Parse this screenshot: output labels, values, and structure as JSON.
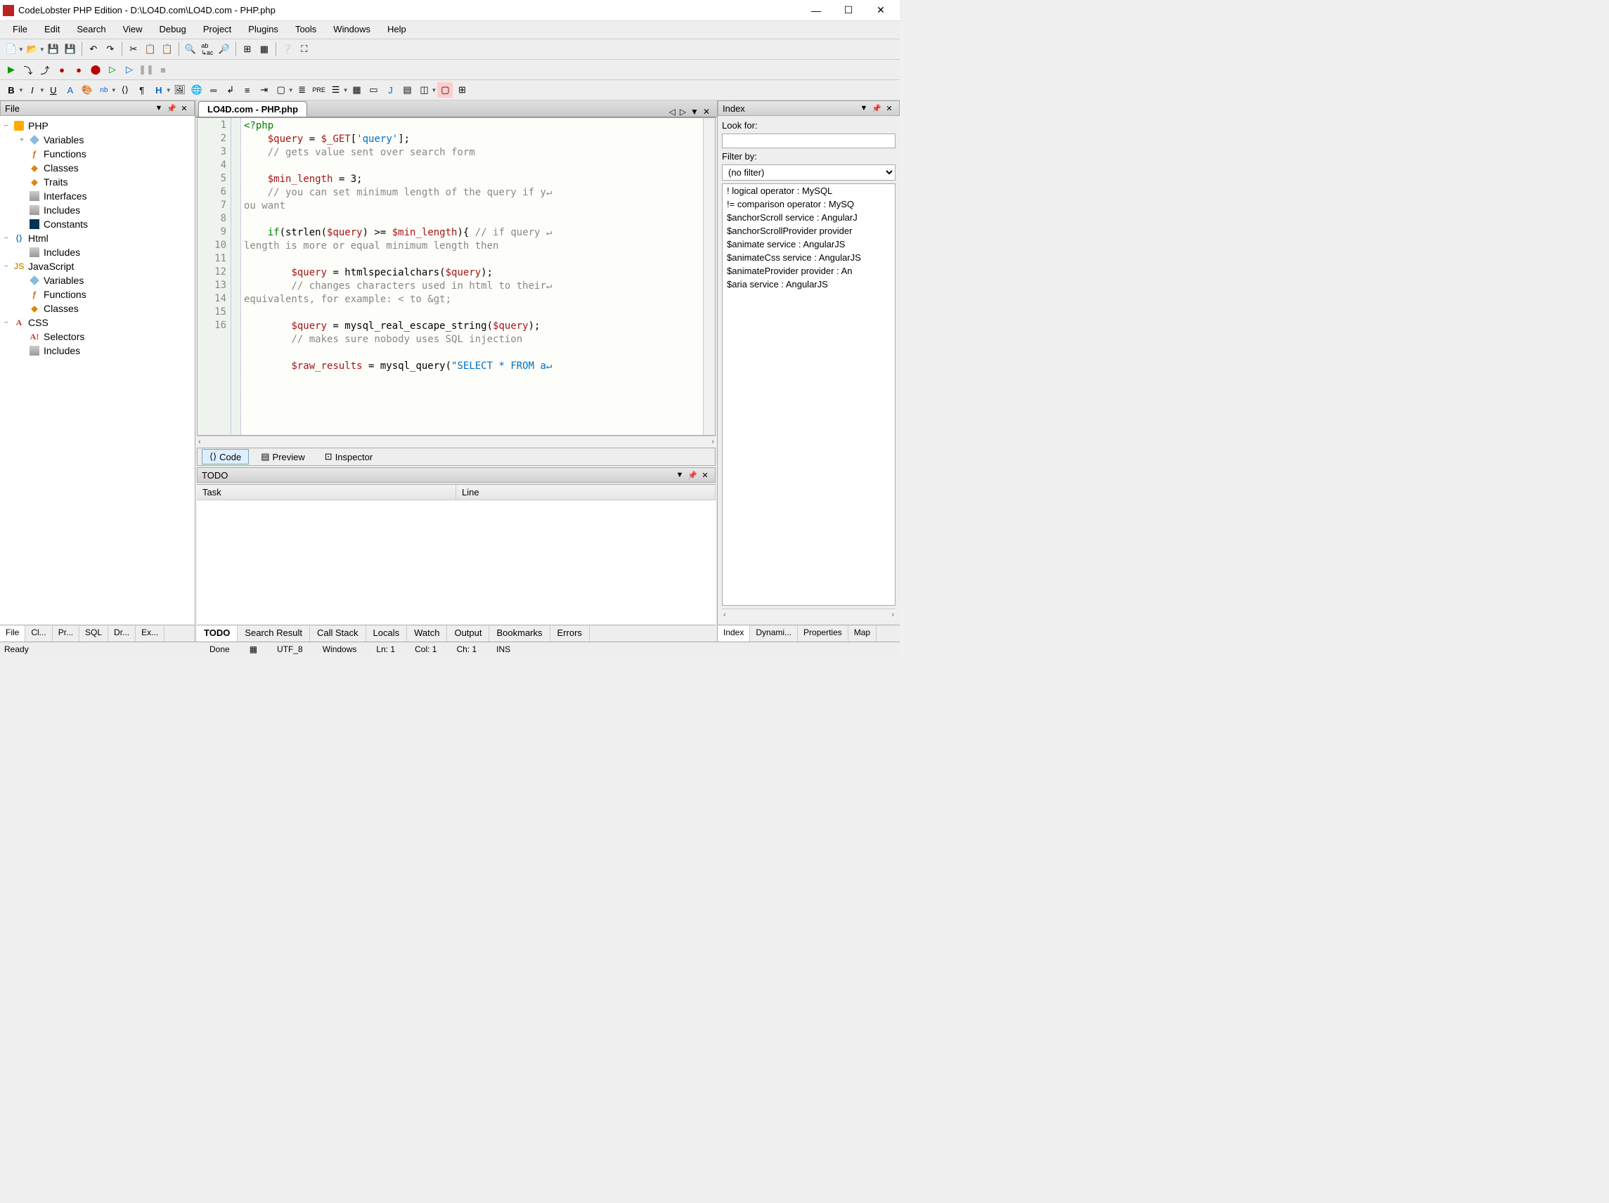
{
  "window": {
    "title": "CodeLobster PHP Edition - D:\\LO4D.com\\LO4D.com - PHP.php"
  },
  "menus": [
    "File",
    "Edit",
    "Search",
    "View",
    "Debug",
    "Project",
    "Plugins",
    "Tools",
    "Windows",
    "Help"
  ],
  "left_panel": {
    "title": "File",
    "tree": [
      {
        "label": "PHP",
        "icon": "php",
        "expander": "−",
        "level": 0,
        "children": true
      },
      {
        "label": "Variables",
        "icon": "cube",
        "expander": "+",
        "level": 1
      },
      {
        "label": "Functions",
        "icon": "func",
        "expander": "",
        "level": 1
      },
      {
        "label": "Classes",
        "icon": "class",
        "expander": "",
        "level": 1
      },
      {
        "label": "Traits",
        "icon": "class",
        "expander": "",
        "level": 1
      },
      {
        "label": "Interfaces",
        "icon": "inc",
        "expander": "",
        "level": 1
      },
      {
        "label": "Includes",
        "icon": "inc",
        "expander": "",
        "level": 1
      },
      {
        "label": "Constants",
        "icon": "const",
        "expander": "",
        "level": 1
      },
      {
        "label": "Html",
        "icon": "html",
        "expander": "−",
        "level": 0,
        "children": true
      },
      {
        "label": "Includes",
        "icon": "inc",
        "expander": "",
        "level": 1
      },
      {
        "label": "JavaScript",
        "icon": "js",
        "expander": "−",
        "level": 0,
        "children": true
      },
      {
        "label": "Variables",
        "icon": "cube",
        "expander": "",
        "level": 1
      },
      {
        "label": "Functions",
        "icon": "func",
        "expander": "",
        "level": 1
      },
      {
        "label": "Classes",
        "icon": "class",
        "expander": "",
        "level": 1
      },
      {
        "label": "CSS",
        "icon": "css",
        "expander": "−",
        "level": 0,
        "children": true
      },
      {
        "label": "Selectors",
        "icon": "sel",
        "expander": "",
        "level": 1
      },
      {
        "label": "Includes",
        "icon": "inc",
        "expander": "",
        "level": 1
      }
    ],
    "tabs": [
      "File",
      "Cl...",
      "Pr...",
      "SQL",
      "Dr...",
      "Ex..."
    ]
  },
  "editor": {
    "tab": "LO4D.com - PHP.php",
    "lines": [
      "1",
      "2",
      "3",
      "4",
      "5",
      "6",
      "7",
      "8",
      "9",
      "10",
      "11",
      "12",
      "13",
      "14",
      "15",
      "16"
    ],
    "code_html": "<span class='kw'>&lt;?php</span>\n    <span class='var'>$query</span> = <span class='var'>$_GET</span>[<span class='str'>'query'</span>];\n    <span class='cmt'>// gets value sent over search form</span>\n\n    <span class='var'>$min_length</span> = 3;\n    <span class='cmt'>// you can set minimum length of the query if y↵\nou want</span>\n\n    <span class='kw'>if</span>(strlen(<span class='var'>$query</span>) &gt;= <span class='var'>$min_length</span>){ <span class='cmt'>// if query ↵\nlength is more or equal minimum length then</span>\n\n        <span class='var'>$query</span> = htmlspecialchars(<span class='var'>$query</span>);\n        <span class='cmt'>// changes characters used in html to their↵\nequivalents, for example: &lt; to &amp;gt;</span>\n\n        <span class='var'>$query</span> = mysql_real_escape_string(<span class='var'>$query</span>);\n        <span class='cmt'>// makes sure nobody uses SQL injection</span>\n\n        <span class='var'>$raw_results</span> = mysql_query(<span class='str'>\"SELECT * FROM a↵</span>",
    "bottom_tabs": [
      "Code",
      "Preview",
      "Inspector"
    ]
  },
  "todo": {
    "title": "TODO",
    "cols": [
      "Task",
      "Line"
    ]
  },
  "bottom_tabs": [
    "TODO",
    "Search Result",
    "Call Stack",
    "Locals",
    "Watch",
    "Output",
    "Bookmarks",
    "Errors"
  ],
  "right_panel": {
    "title": "Index",
    "look_for": "Look for:",
    "filter_by": "Filter by:",
    "filter_value": "(no filter)",
    "items": [
      "! logical operator : MySQL",
      "!= comparison operator : MySQ",
      "$anchorScroll service : AngularJ",
      "$anchorScrollProvider provider",
      "$animate service : AngularJS",
      "$animateCss service : AngularJS",
      "$animateProvider provider : An",
      "$aria service : AngularJS"
    ],
    "tabs": [
      "Index",
      "Dynami...",
      "Properties",
      "Map"
    ]
  },
  "status": {
    "left": "Ready",
    "done": "Done",
    "encoding": "UTF_8",
    "platform": "Windows",
    "ln": "Ln: 1",
    "col": "Col: 1",
    "ch": "Ch: 1",
    "ins": "INS"
  }
}
